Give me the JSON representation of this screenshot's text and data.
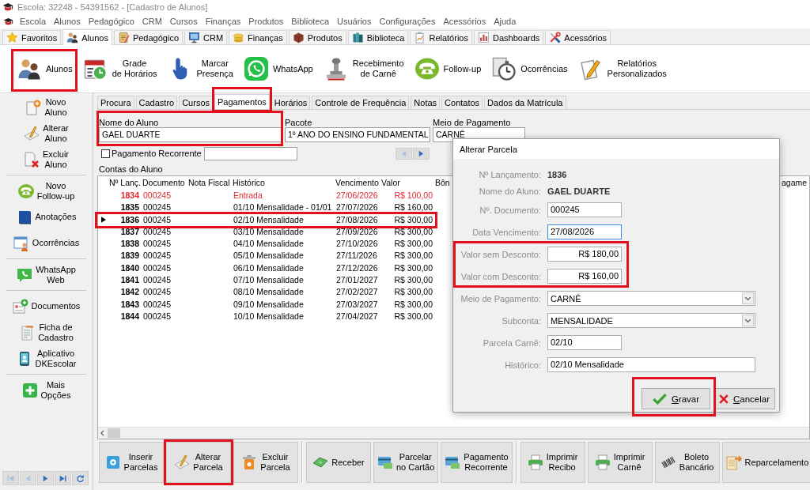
{
  "window": {
    "title": "Escola: 32248 - 54391562 - [Cadastro de Alunos]"
  },
  "menu": [
    "Escola",
    "Alunos",
    "Pedagógico",
    "CRM",
    "Cursos",
    "Finanças",
    "Produtos",
    "Biblioteca",
    "Usuários",
    "Configurações",
    "Acessórios",
    "Ajuda"
  ],
  "ribbon_tabs": [
    {
      "label": "Favoritos",
      "selected": false
    },
    {
      "label": "Alunos",
      "selected": true
    },
    {
      "label": "Pedagógico",
      "selected": false
    },
    {
      "label": "CRM",
      "selected": false
    },
    {
      "label": "Finanças",
      "selected": false
    },
    {
      "label": "Produtos",
      "selected": false
    },
    {
      "label": "Biblioteca",
      "selected": false
    },
    {
      "label": "Relatórios",
      "selected": false
    },
    {
      "label": "Dashboards",
      "selected": false
    },
    {
      "label": "Acessórios",
      "selected": false
    }
  ],
  "ribbon_buttons": [
    {
      "lines": [
        "Alunos"
      ],
      "highlighted": true
    },
    {
      "lines": [
        "Grade",
        "de Horários"
      ],
      "highlighted": false
    },
    {
      "lines": [
        "Marcar",
        "Presença"
      ],
      "highlighted": false
    },
    {
      "lines": [
        "WhatsApp"
      ],
      "highlighted": false
    },
    {
      "lines": [
        "Recebimento",
        "de Carnê"
      ],
      "highlighted": false
    },
    {
      "lines": [
        "Follow-up"
      ],
      "highlighted": false
    },
    {
      "lines": [
        "Ocorrências"
      ],
      "highlighted": false
    },
    {
      "lines": [
        "Relatórios",
        "Personalizados"
      ],
      "highlighted": false
    }
  ],
  "sidebar": {
    "groups": [
      {
        "items": [
          {
            "lines": [
              "Novo",
              "Aluno"
            ]
          },
          {
            "lines": [
              "Alterar",
              "Aluno"
            ]
          },
          {
            "lines": [
              "Excluir",
              "Aluno"
            ]
          }
        ]
      },
      {
        "items": [
          {
            "lines": [
              "Novo",
              "Follow-up"
            ]
          },
          {
            "lines": [
              "Anotações"
            ]
          },
          {
            "lines": [
              "Ocorrências"
            ]
          }
        ]
      },
      {
        "items": [
          {
            "lines": [
              "WhatsApp",
              "Web"
            ]
          }
        ]
      },
      {
        "items": [
          {
            "lines": [
              "Documentos"
            ]
          },
          {
            "lines": [
              "Ficha de",
              "Cadastro"
            ]
          },
          {
            "lines": [
              "Aplicativo",
              "DKEscolar"
            ]
          }
        ]
      },
      {
        "items": [
          {
            "lines": [
              "Mais",
              "Opções"
            ]
          }
        ]
      }
    ],
    "nav": [
      {
        "kind": "first",
        "disabled": true
      },
      {
        "kind": "previous",
        "disabled": true
      },
      {
        "kind": "next",
        "disabled": false
      },
      {
        "kind": "last",
        "disabled": false
      },
      {
        "kind": "refresh",
        "disabled": false
      }
    ]
  },
  "page_tabs": [
    {
      "label": "Procura",
      "selected": false,
      "highlighted": false
    },
    {
      "label": "Cadastro",
      "selected": false,
      "highlighted": false
    },
    {
      "label": "Cursos",
      "selected": false,
      "highlighted": false
    },
    {
      "label": "Pagamentos",
      "selected": true,
      "highlighted": true
    },
    {
      "label": "Horários",
      "selected": false,
      "highlighted": false
    },
    {
      "label": "Controle de Frequência",
      "selected": false,
      "highlighted": false
    },
    {
      "label": "Notas",
      "selected": false,
      "highlighted": false
    },
    {
      "label": "Contatos",
      "selected": false,
      "highlighted": false
    },
    {
      "label": "Dados da Matrícula",
      "selected": false,
      "highlighted": false
    }
  ],
  "form": {
    "fields": [
      {
        "label": "Nome do Aluno",
        "value": "GAEL DUARTE",
        "highlighted": true
      },
      {
        "label": "Pacote",
        "value": "1º ANO DO ENSINO FUNDAMENTAL",
        "highlighted": false
      },
      {
        "label": "Meio de Pagamento",
        "value": "CARNÊ",
        "highlighted": false
      }
    ],
    "recurring": {
      "label": "Pagamento Recorrente",
      "checked": false
    },
    "pager": [
      {
        "kind": "previous",
        "disabled": true
      },
      {
        "kind": "next",
        "disabled": false
      }
    ]
  },
  "accounts": {
    "title": "Contas do Aluno",
    "columns": [
      "Nº Lanç.",
      "Documento",
      "Nota Fiscal",
      "Histórico",
      "Vencimento",
      "Valor",
      "Bôn",
      "agame"
    ],
    "rows": [
      {
        "number": "1834",
        "document": "000245",
        "history": "Entrada",
        "due": "27/06/2026",
        "value": "R$ 100,00",
        "color": "#e3262b",
        "selected": false,
        "highlighted": false
      },
      {
        "number": "1835",
        "document": "000245",
        "history": "01/10 Mensalidade - 01/01",
        "due": "27/07/2026",
        "value": "R$ 160,00",
        "color": "#000000",
        "selected": false,
        "highlighted": false
      },
      {
        "number": "1836",
        "document": "000245",
        "history": "02/10 Mensalidade",
        "due": "27/08/2026",
        "value": "R$ 300,00",
        "color": "#000000",
        "selected": true,
        "highlighted": true
      },
      {
        "number": "1837",
        "document": "000245",
        "history": "03/10 Mensalidade",
        "due": "27/09/2026",
        "value": "R$ 300,00",
        "color": "#000000",
        "selected": false,
        "highlighted": false
      },
      {
        "number": "1838",
        "document": "000245",
        "history": "04/10 Mensalidade",
        "due": "27/10/2026",
        "value": "R$ 300,00",
        "color": "#000000",
        "selected": false,
        "highlighted": false
      },
      {
        "number": "1839",
        "document": "000245",
        "history": "05/10 Mensalidade",
        "due": "27/11/2026",
        "value": "R$ 300,00",
        "color": "#000000",
        "selected": false,
        "highlighted": false
      },
      {
        "number": "1840",
        "document": "000245",
        "history": "06/10 Mensalidade",
        "due": "27/12/2026",
        "value": "R$ 300,00",
        "color": "#000000",
        "selected": false,
        "highlighted": false
      },
      {
        "number": "1841",
        "document": "000245",
        "history": "07/10 Mensalidade",
        "due": "27/01/2027",
        "value": "R$ 300,00",
        "color": "#000000",
        "selected": false,
        "highlighted": false
      },
      {
        "number": "1842",
        "document": "000245",
        "history": "08/10 Mensalidade",
        "due": "27/02/2027",
        "value": "R$ 300,00",
        "color": "#000000",
        "selected": false,
        "highlighted": false
      },
      {
        "number": "1843",
        "document": "000245",
        "history": "09/10 Mensalidade",
        "due": "27/03/2027",
        "value": "R$ 300,00",
        "color": "#000000",
        "selected": false,
        "highlighted": false
      },
      {
        "number": "1844",
        "document": "000245",
        "history": "10/10 Mensalidade",
        "due": "27/04/2027",
        "value": "R$ 300,00",
        "color": "#000000",
        "selected": false,
        "highlighted": false
      }
    ]
  },
  "dialog": {
    "title": "Alterar Parcela",
    "info": [
      {
        "label": "Nº Lançamento:",
        "value": "1836"
      },
      {
        "label": "Nome do Aluno:",
        "value": "GAEL DUARTE"
      }
    ],
    "sections": [
      {
        "highlighted": false,
        "fields": [
          {
            "kind": "short",
            "label": "Nº. Documento:",
            "value": "000245",
            "focused": false
          },
          {
            "kind": "short",
            "label": "Data Vencimento:",
            "value": "27/08/2026",
            "focused": true
          }
        ]
      },
      {
        "highlighted": true,
        "fields": [
          {
            "kind": "money",
            "label": "Valor sem Desconto:",
            "value": "R$ 180,00",
            "focused": false
          },
          {
            "kind": "money",
            "label": "Valor com Desconto:",
            "value": "R$ 160,00",
            "focused": false
          }
        ]
      },
      {
        "highlighted": false,
        "fields": [
          {
            "kind": "select",
            "label": "Meio de Pagamento:",
            "value": "CARNÊ",
            "focused": false
          },
          {
            "kind": "select",
            "label": "Subconta:",
            "value": "MENSALIDADE",
            "focused": false
          },
          {
            "kind": "short",
            "label": "Parcela Carnê:",
            "value": "02/10",
            "focused": false
          },
          {
            "kind": "long",
            "label": "Histórico:",
            "value": "02/10 Mensalidade",
            "focused": false
          }
        ]
      }
    ],
    "buttons": [
      {
        "kind": "save",
        "label": "Gravar",
        "highlighted": true
      },
      {
        "kind": "cancel",
        "label": "Cancelar",
        "highlighted": false
      }
    ]
  },
  "actions": {
    "groups": [
      {
        "buttons": [
          {
            "lines": [
              "Inserir",
              "Parcelas"
            ],
            "highlighted": false
          },
          {
            "lines": [
              "Alterar",
              "Parcela"
            ],
            "highlighted": true
          },
          {
            "lines": [
              "Excluir",
              "Parcela"
            ],
            "highlighted": false
          }
        ]
      },
      {
        "buttons": [
          {
            "lines": [
              "Receber"
            ],
            "highlighted": false
          },
          {
            "lines": [
              "Parcelar",
              "no Cartão"
            ],
            "highlighted": false
          },
          {
            "lines": [
              "Pagamento",
              "Recorrente"
            ],
            "highlighted": false
          }
        ]
      },
      {
        "buttons": [
          {
            "lines": [
              "Imprimir",
              "Recibo"
            ],
            "highlighted": false
          },
          {
            "lines": [
              "Imprimir",
              "Carnê"
            ],
            "highlighted": false
          },
          {
            "lines": [
              "Boleto",
              "Bancário"
            ],
            "highlighted": false
          },
          {
            "lines": [
              "Reparcelamento"
            ],
            "highlighted": false
          }
        ]
      }
    ]
  }
}
